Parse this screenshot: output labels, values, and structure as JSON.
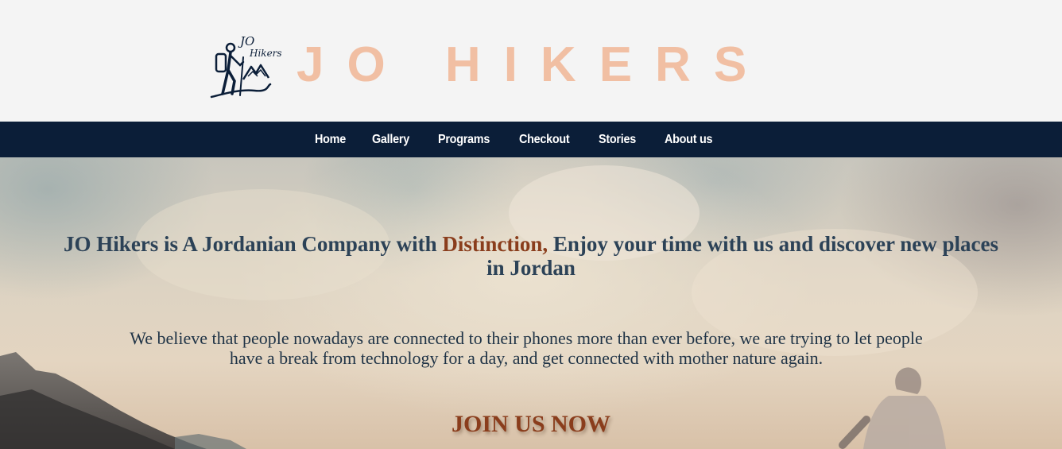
{
  "header": {
    "logo": {
      "text_top": "JO",
      "text_bottom": "Hikers",
      "icon": "hiker-logo-icon"
    },
    "title": "JO HIKERS"
  },
  "nav": {
    "items": [
      {
        "label": "Home"
      },
      {
        "label": "Gallery"
      },
      {
        "label": "Programs"
      },
      {
        "label": "Checkout"
      },
      {
        "label": "Stories"
      },
      {
        "label": "About us"
      }
    ]
  },
  "hero": {
    "heading_before": "JO Hikers is A Jordanian Company with ",
    "heading_highlight": "Distinction,",
    "heading_after": " Enjoy your time with us and discover new places in Jordan",
    "paragraph": "We believe that people nowadays are connected to their phones more than ever before, we are trying to let people have a break from technology for a day, and get connected with mother nature again.",
    "cta": "JOIN US NOW"
  },
  "colors": {
    "title": "#f1bfa3",
    "navbar": "#0b1e38",
    "heading": "#2c4257",
    "accent": "#8a3d1c"
  }
}
